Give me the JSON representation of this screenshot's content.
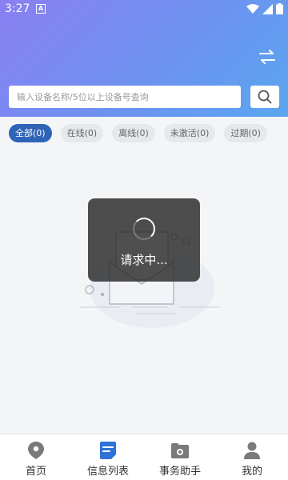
{
  "status_bar": {
    "time": "3:27",
    "notification_letter": "A"
  },
  "search": {
    "placeholder": "输入设备名称/5位以上设备号查询"
  },
  "filters": [
    {
      "label": "全部(0)",
      "active": true
    },
    {
      "label": "在线(0)",
      "active": false
    },
    {
      "label": "离线(0)",
      "active": false
    },
    {
      "label": "未激活(0)",
      "active": false
    },
    {
      "label": "过期(0)",
      "active": false
    }
  ],
  "loading": {
    "text": "请求中..."
  },
  "bottom_nav": [
    {
      "label": "首页",
      "icon": "location-pin-icon"
    },
    {
      "label": "信息列表",
      "icon": "document-icon",
      "active": true
    },
    {
      "label": "事务助手",
      "icon": "camera-folder-icon"
    },
    {
      "label": "我的",
      "icon": "user-icon"
    }
  ],
  "colors": {
    "header_start": "#8a7ff3",
    "header_end": "#5aa6f0",
    "accent": "#2f63b7",
    "nav_active": "#2f73d9",
    "nav_inactive": "#666666"
  }
}
